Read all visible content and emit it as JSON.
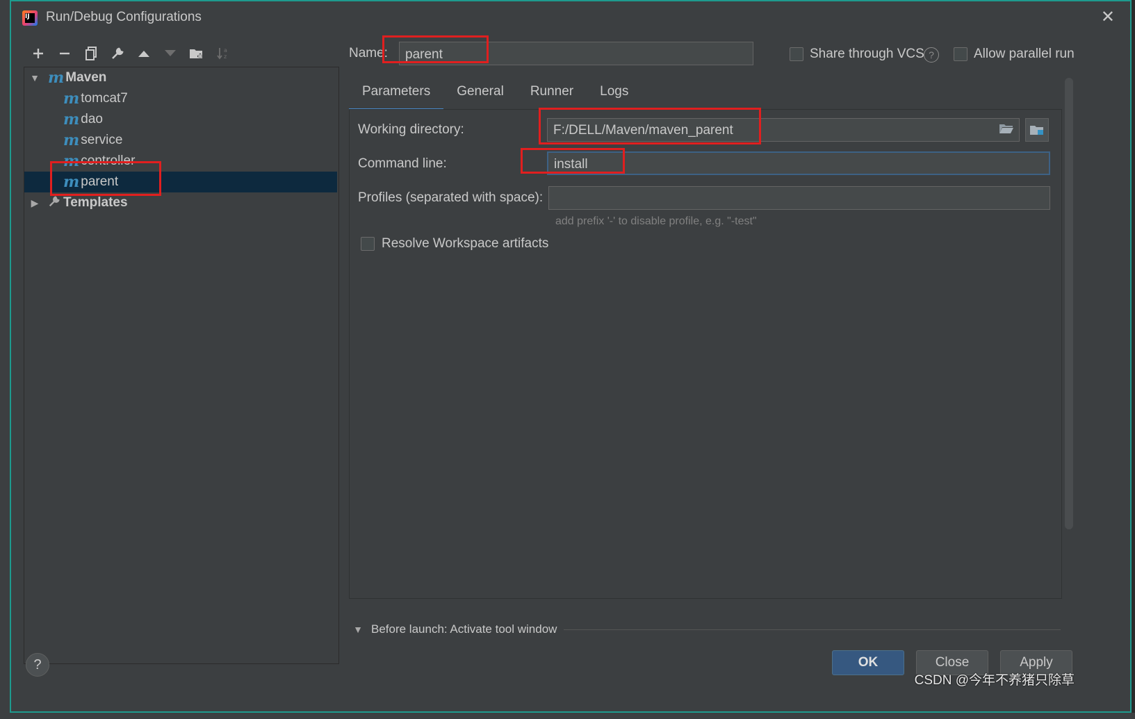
{
  "window": {
    "title": "Run/Debug Configurations",
    "close_glyph": "✕",
    "logo_text": "IJ"
  },
  "toolbar": {
    "icons": [
      "add-icon",
      "remove-icon",
      "copy-icon",
      "wrench-icon",
      "move-up-icon",
      "move-down-icon",
      "new-folder-icon",
      "sort-icon"
    ]
  },
  "tree": {
    "maven_group": "Maven",
    "items": [
      "tomcat7",
      "dao",
      "service",
      "controller",
      "parent"
    ],
    "selected": "parent",
    "templates": "Templates",
    "m_glyph": "m"
  },
  "form": {
    "name_label": "Name:",
    "name_value": "parent",
    "share_vcs_label": "Share through VCS",
    "allow_parallel_label": "Allow parallel run",
    "tabs": [
      "Parameters",
      "General",
      "Runner",
      "Logs"
    ],
    "active_tab": "Parameters",
    "working_dir_label": "Working directory:",
    "working_dir_value": "F:/DELL/Maven/maven_parent",
    "command_line_label": "Command line:",
    "command_line_value": "install",
    "profiles_label": "Profiles (separated with space):",
    "profiles_value": "",
    "profiles_hint": "add prefix '-' to disable profile, e.g. \"-test\"",
    "resolve_workspace_label": "Resolve Workspace artifacts"
  },
  "before_launch": "Before launch: Activate tool window",
  "buttons": {
    "ok": "OK",
    "close": "Close",
    "apply": "Apply",
    "help": "?"
  },
  "watermark": "CSDN @今年不养猪只除草",
  "colors": {
    "dialog_bg": "#3c3f41",
    "selection": "#0d293e",
    "accent": "#4a88c7",
    "highlight_box": "#e01f1f",
    "maven_icon": "#3d8ebd"
  }
}
